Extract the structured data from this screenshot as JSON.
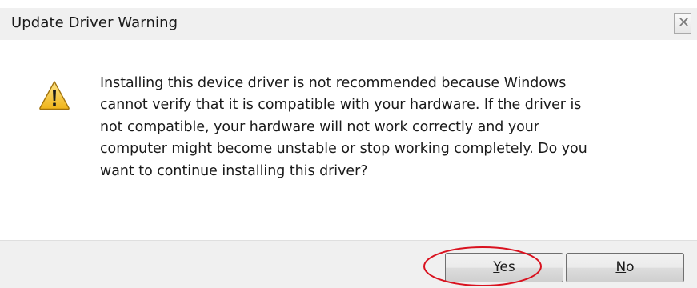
{
  "window": {
    "title": "Update Driver Warning",
    "close_icon": "close-icon"
  },
  "message": {
    "icon": "warning-icon",
    "lines": [
      "Installing this device driver is not recommended because Windows",
      "cannot verify that it is compatible with your hardware.  If the driver is",
      "not compatible, your hardware will not work correctly and your",
      "computer might become unstable or stop working completely.  Do you",
      "want to continue installing this driver?"
    ]
  },
  "buttons": {
    "yes": {
      "accel": "Y",
      "rest": "es"
    },
    "no": {
      "accel": "N",
      "rest": "o"
    }
  },
  "colors": {
    "annotation": "#d9121f",
    "warning_fill": "#f6c232",
    "footer_bg": "#f0f0f0"
  }
}
